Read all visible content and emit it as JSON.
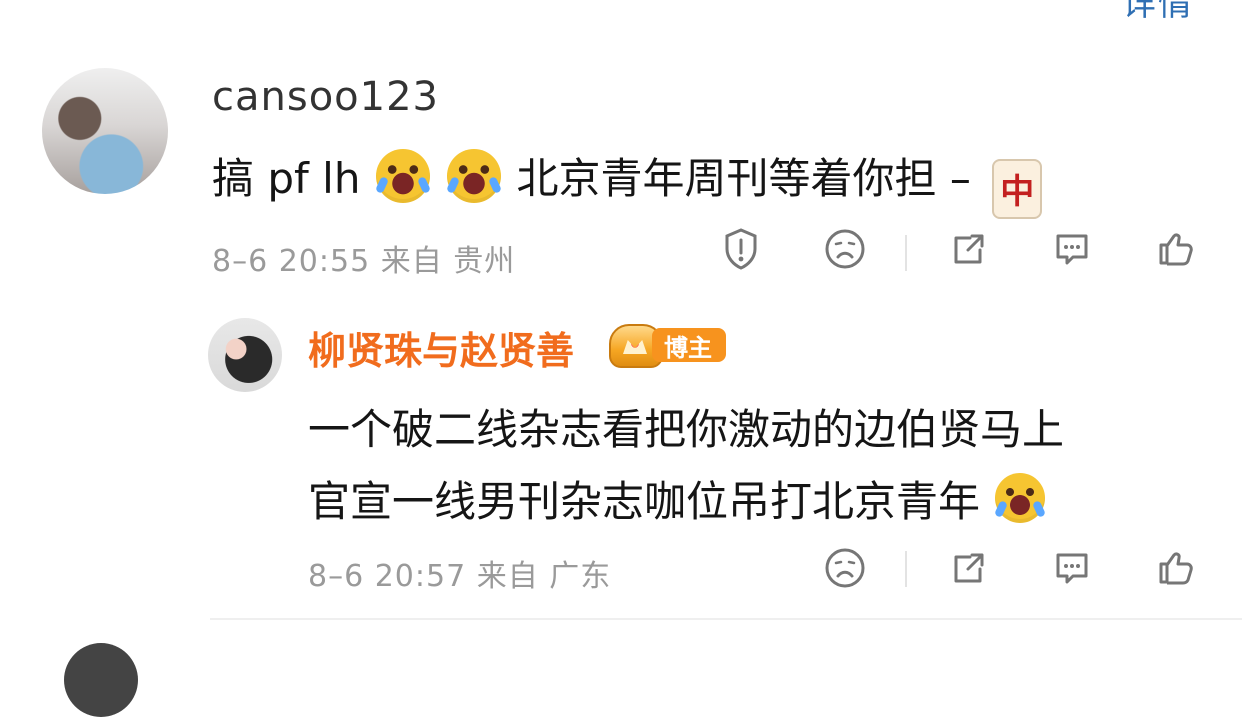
{
  "top_fragment": "详情",
  "comment": {
    "username": "cansoo123",
    "text_before_emoji": "搞 pf lh ",
    "text_after_emoji": "北京青年周刊等着你担 –",
    "emoji_name": "laughing-crying-emoji",
    "mahjong_text": "中",
    "meta": "8–6 20:55 来自 贵州",
    "icons": [
      "report-icon",
      "sad-face-icon",
      "share-icon",
      "comment-icon",
      "like-icon"
    ]
  },
  "reply": {
    "username": "柳贤珠与赵贤善",
    "badge_label": "博主",
    "line1": "一个破二线杂志看把你激动的边伯贤马上",
    "line2": "官宣一线男刊杂志咖位吊打北京青年",
    "emoji_name": "laughing-crying-emoji",
    "meta": "8–6 20:57 来自 广东",
    "icons": [
      "sad-face-icon",
      "share-icon",
      "comment-icon",
      "like-icon"
    ]
  }
}
